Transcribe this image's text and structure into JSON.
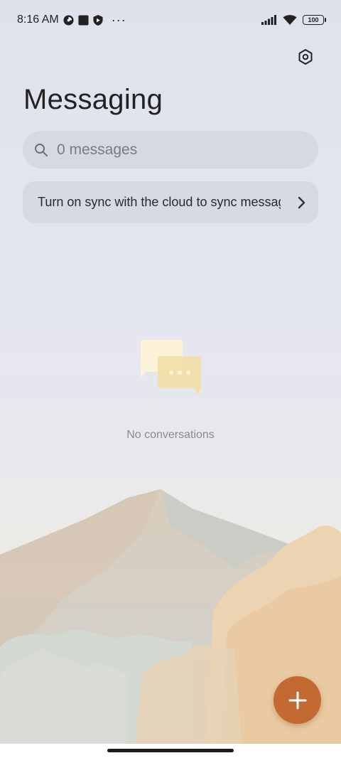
{
  "status_bar": {
    "time": "8:16 AM",
    "dots": "···",
    "battery": "100"
  },
  "header": {
    "title": "Messaging",
    "settings_icon": "settings-hex-icon"
  },
  "search": {
    "placeholder": "0 messages",
    "icon": "search-icon"
  },
  "sync_banner": {
    "text": "Turn on sync with the cloud to sync messages"
  },
  "empty_state": {
    "text": "No conversations",
    "icon": "chat-bubbles-icon"
  },
  "fab": {
    "icon": "plus-icon",
    "color": "#c26a31"
  },
  "colors": {
    "accent": "#c26a31",
    "background": "#e2e4ed"
  }
}
